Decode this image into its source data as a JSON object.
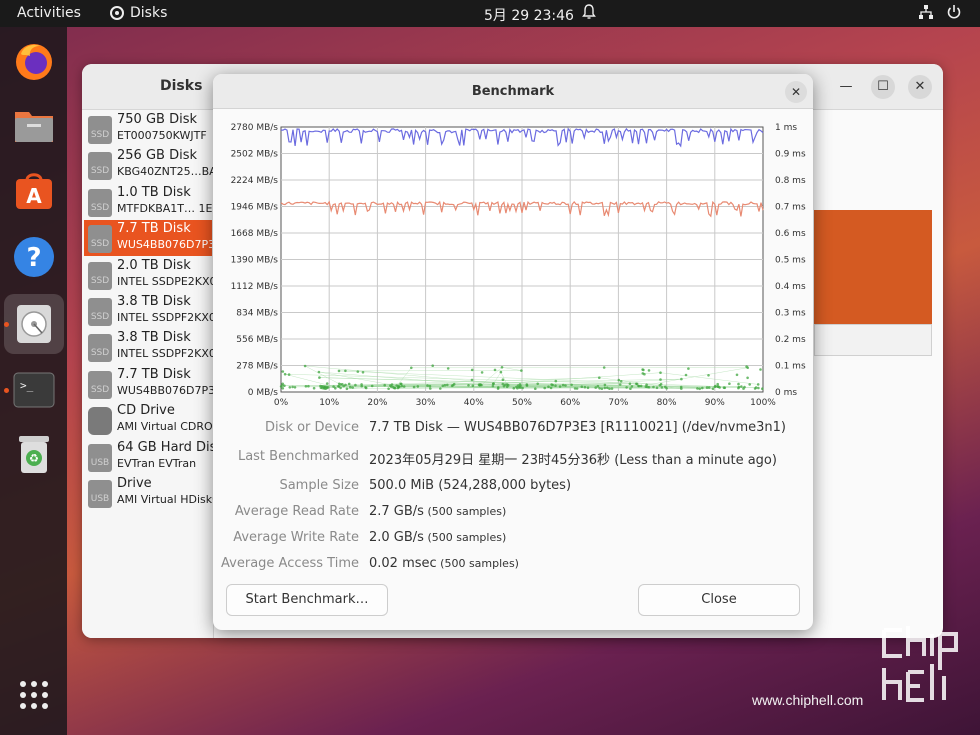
{
  "topbar": {
    "activities": "Activities",
    "app_name": "Disks",
    "clock": "5月 29  23:46"
  },
  "dock": {
    "items": [
      "firefox-icon",
      "files-icon",
      "software-icon",
      "help-icon",
      "disks-icon",
      "terminal-icon",
      "trash-icon",
      "app-grid-icon"
    ]
  },
  "disks_window": {
    "title": "Disks",
    "disks": [
      {
        "name": "750 GB Disk",
        "sub": "ET000750KWJTF",
        "icon": "SSD"
      },
      {
        "name": "256 GB Disk",
        "sub": "KBG40ZNT25…BA",
        "icon": "SSD"
      },
      {
        "name": "1.0 TB Disk",
        "sub": "MTFDKBA1T… 1E",
        "icon": "SSD"
      },
      {
        "name": "7.7 TB Disk",
        "sub": "WUS4BB076D7P3",
        "icon": "SSD"
      },
      {
        "name": "2.0 TB Disk",
        "sub": "INTEL SSDPE2KX0",
        "icon": "SSD"
      },
      {
        "name": "3.8 TB Disk",
        "sub": "INTEL SSDPF2KX0",
        "icon": "SSD"
      },
      {
        "name": "3.8 TB Disk",
        "sub": "INTEL SSDPF2KX0",
        "icon": "SSD"
      },
      {
        "name": "7.7 TB Disk",
        "sub": "WUS4BB076D7P3",
        "icon": "SSD"
      },
      {
        "name": "CD Drive",
        "sub": "AMI Virtual CDRO",
        "icon": ""
      },
      {
        "name": "64 GB Hard Disk",
        "sub": "EVTran EVTran",
        "icon": "USB"
      },
      {
        "name": "Drive",
        "sub": "AMI Virtual HDisk0",
        "icon": "USB"
      }
    ],
    "selected_index": 3
  },
  "benchmark": {
    "title": "Benchmark",
    "info": [
      {
        "key": "Disk or Device",
        "value": "7.7 TB Disk — WUS4BB076D7P3E3 [R1110021] (/dev/nvme3n1)",
        "note": ""
      },
      {
        "key": "Last Benchmarked",
        "value": "2023年05月29日 星期一 23时45分36秒 (Less than a minute ago)",
        "note": ""
      },
      {
        "key": "Sample Size",
        "value": "500.0 MiB (524,288,000 bytes)",
        "note": ""
      },
      {
        "key": "Average Read Rate",
        "value": "2.7 GB/s",
        "note": "(500 samples)"
      },
      {
        "key": "Average Write Rate",
        "value": "2.0 GB/s",
        "note": "(500 samples)"
      },
      {
        "key": "Average Access Time",
        "value": "0.02 msec",
        "note": "(500 samples)"
      }
    ],
    "start_button": "Start Benchmark…",
    "close_button": "Close"
  },
  "chart_data": {
    "type": "line",
    "y_left_ticks": [
      "2780 MB/s",
      "2502 MB/s",
      "2224 MB/s",
      "1946 MB/s",
      "1668 MB/s",
      "1390 MB/s",
      "1112 MB/s",
      "834 MB/s",
      "556 MB/s",
      "278 MB/s",
      "0 MB/s"
    ],
    "y_right_ticks": [
      "1 ms",
      "0.9 ms",
      "0.8 ms",
      "0.7 ms",
      "0.6 ms",
      "0.5 ms",
      "0.4 ms",
      "0.3 ms",
      "0.2 ms",
      "0.1 ms",
      "0 ms"
    ],
    "x_ticks": [
      "0%",
      "10%",
      "20%",
      "30%",
      "40%",
      "50%",
      "60%",
      "70%",
      "80%",
      "90%",
      "100%"
    ],
    "ylim_left": [
      0,
      2780
    ],
    "ylim_right": [
      0,
      1
    ],
    "xlim": [
      0,
      100
    ],
    "series": [
      {
        "role": "read",
        "color": "#6b6be0",
        "unit": "MB/s",
        "approx_mean": 2700,
        "approx_min": 2580,
        "approx_max": 2780
      },
      {
        "role": "write",
        "color": "#e88a72",
        "unit": "MB/s",
        "approx_mean": 1980,
        "approx_min": 1840,
        "approx_max": 2010
      },
      {
        "role": "access",
        "color": "#3fa53f",
        "unit": "ms",
        "approx_mean": 0.02,
        "approx_min": 0.0,
        "approx_max": 0.1
      }
    ],
    "grid": true
  },
  "watermark": {
    "url": "www.chiphell.com",
    "logo_text": "chip hell"
  }
}
